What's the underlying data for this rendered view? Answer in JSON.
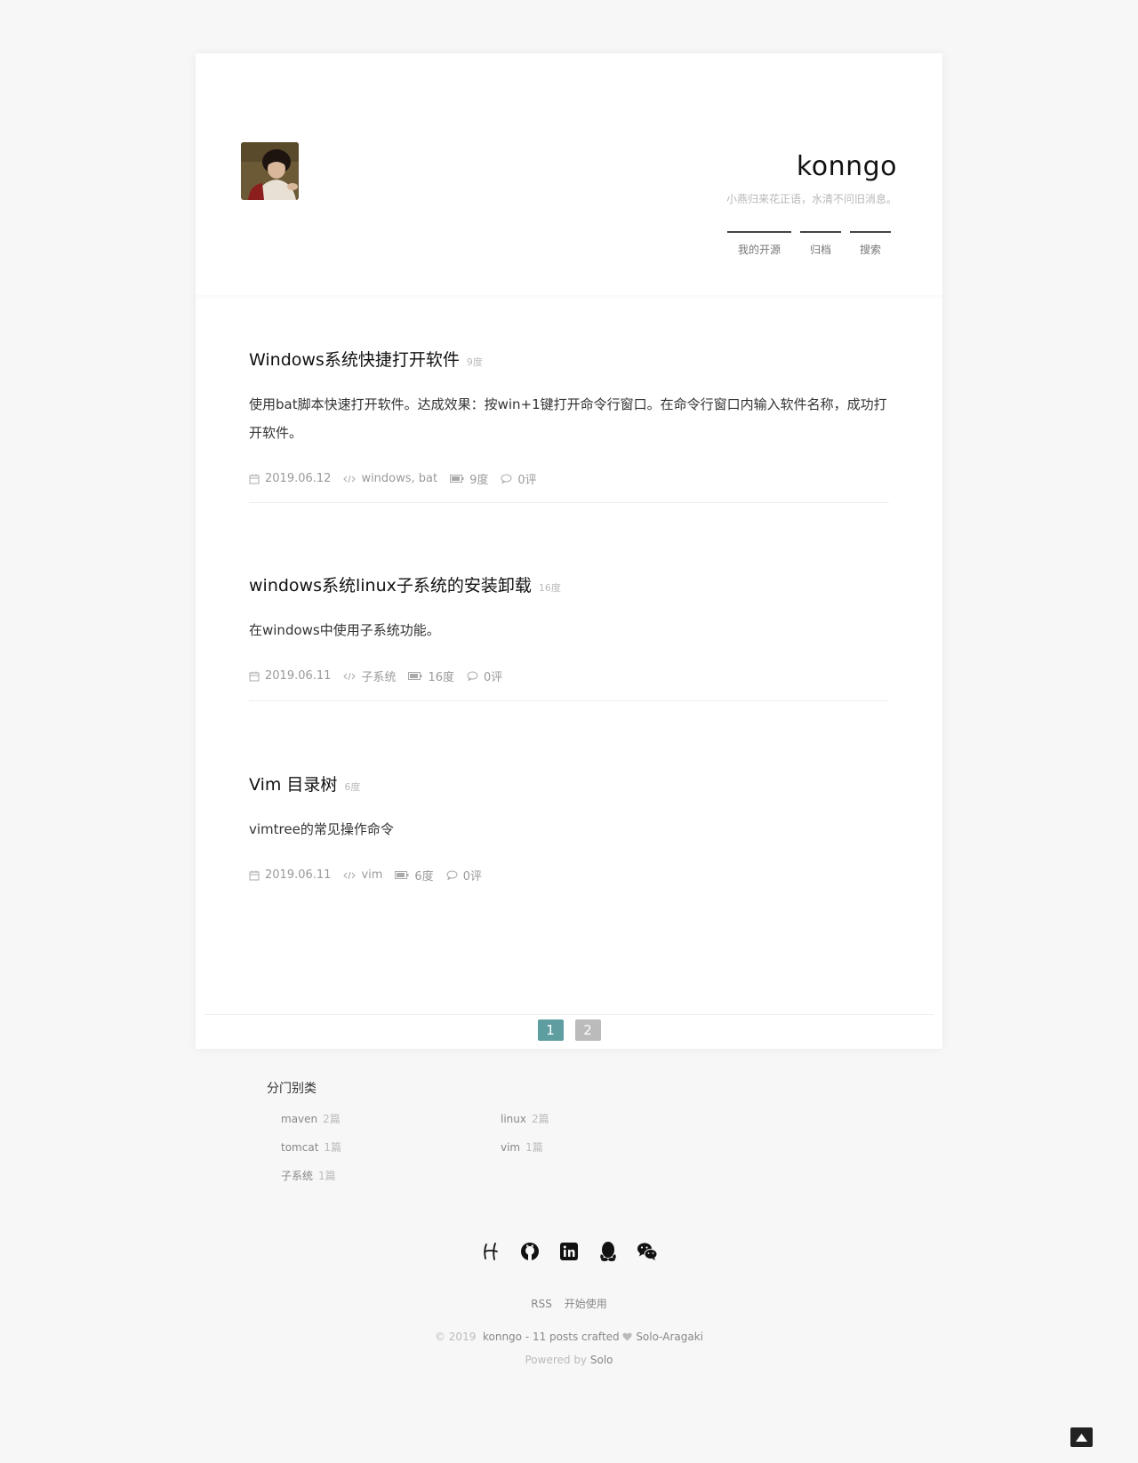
{
  "header": {
    "title": "konngo",
    "subtitle": "小燕归来花正语，水清不问旧消息。",
    "nav": [
      {
        "label": "我的开源"
      },
      {
        "label": "归档"
      },
      {
        "label": "搜索"
      }
    ]
  },
  "posts": [
    {
      "title": "Windows系统快捷打开软件",
      "heat": "9度",
      "abstract": "使用bat脚本快速打开软件。达成效果：按win+1键打开命令行窗口。在命令行窗口内输入软件名称，成功打开软件。",
      "date": "2019.06.12",
      "tags": "windows,  bat",
      "views": "9度",
      "comments": "0评"
    },
    {
      "title": "windows系统linux子系统的安装卸载",
      "heat": "16度",
      "abstract": "在windows中使用子系统功能。",
      "date": "2019.06.11",
      "tags": "子系统",
      "views": "16度",
      "comments": "0评"
    },
    {
      "title": "Vim 目录树",
      "heat": "6度",
      "abstract": "vimtree的常见操作命令",
      "date": "2019.06.11",
      "tags": "vim",
      "views": "6度",
      "comments": "0评"
    }
  ],
  "pagination": {
    "pages": [
      "1",
      "2"
    ],
    "current": "1"
  },
  "categories": {
    "title": "分门别类",
    "items": [
      {
        "name": "maven",
        "count": "2篇"
      },
      {
        "name": "linux",
        "count": "2篇"
      },
      {
        "name": "tomcat",
        "count": "1篇"
      },
      {
        "name": "vim",
        "count": "1篇"
      },
      {
        "name": "子系统",
        "count": "1篇"
      }
    ]
  },
  "footer": {
    "social": [
      "hacpai-icon",
      "github-icon",
      "linkedin-icon",
      "qq-icon",
      "wechat-icon"
    ],
    "links": [
      "RSS",
      "开始使用"
    ],
    "copyright_prefix": "© 2019",
    "copyright_blog": "konngo - 11 posts crafted",
    "copyright_theme": "Solo-Aragaki",
    "powered_prefix": "Powered by",
    "powered_name": "Solo"
  },
  "colors": {
    "accent": "#5e9ea0",
    "page_inactive": "#bbbbbb",
    "background": "#f7f7f7"
  }
}
